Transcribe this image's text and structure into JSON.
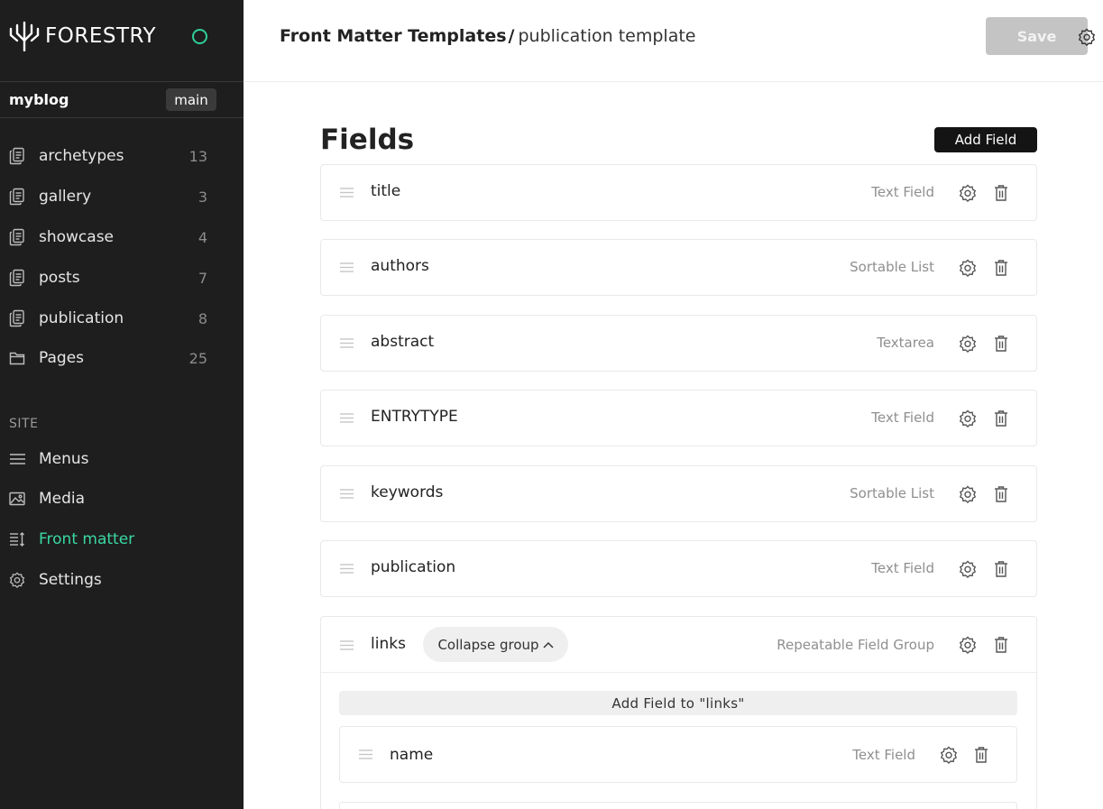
{
  "brand": {
    "name": "FORESTRY",
    "logo_icon": "forestry-logo-icon"
  },
  "repo": {
    "name": "myblog",
    "branch": "main"
  },
  "sidebar": {
    "sections": [
      {
        "label": "archetypes",
        "count": "13",
        "icon": "document-icon"
      },
      {
        "label": "gallery",
        "count": "3",
        "icon": "document-icon"
      },
      {
        "label": "showcase",
        "count": "4",
        "icon": "document-icon"
      },
      {
        "label": "posts",
        "count": "7",
        "icon": "document-icon"
      },
      {
        "label": "publication",
        "count": "8",
        "icon": "document-icon"
      },
      {
        "label": "Pages",
        "count": "25",
        "icon": "folder-icon"
      }
    ],
    "site_heading": "SITE",
    "site_items": [
      {
        "label": "Menus",
        "icon": "menu-icon"
      },
      {
        "label": "Media",
        "icon": "image-icon"
      },
      {
        "label": "Front matter",
        "icon": "front-matter-icon",
        "active": true
      },
      {
        "label": "Settings",
        "icon": "gear-icon"
      }
    ]
  },
  "header": {
    "breadcrumb_root": "Front Matter Templates",
    "breadcrumb_sep": "/",
    "breadcrumb_current": "publication template",
    "save_label": "Save"
  },
  "main": {
    "title": "Fields",
    "add_field_label": "Add Field",
    "fields": [
      {
        "name": "title",
        "type": "Text Field"
      },
      {
        "name": "authors",
        "type": "Sortable List"
      },
      {
        "name": "abstract",
        "type": "Textarea"
      },
      {
        "name": "ENTRYTYPE",
        "type": "Text Field"
      },
      {
        "name": "keywords",
        "type": "Sortable List"
      },
      {
        "name": "publication",
        "type": "Text Field"
      }
    ],
    "group": {
      "name": "links",
      "collapse_label": "Collapse group",
      "type": "Repeatable Field Group",
      "add_label": "Add Field to \"links\"",
      "subfields": [
        {
          "name": "name",
          "type": "Text Field"
        }
      ]
    }
  },
  "colors": {
    "sidebar_bg": "#1e1e1e",
    "accent": "#3ad8a4",
    "primary_button": "#141414",
    "disabled_button": "#c4c4c4"
  }
}
